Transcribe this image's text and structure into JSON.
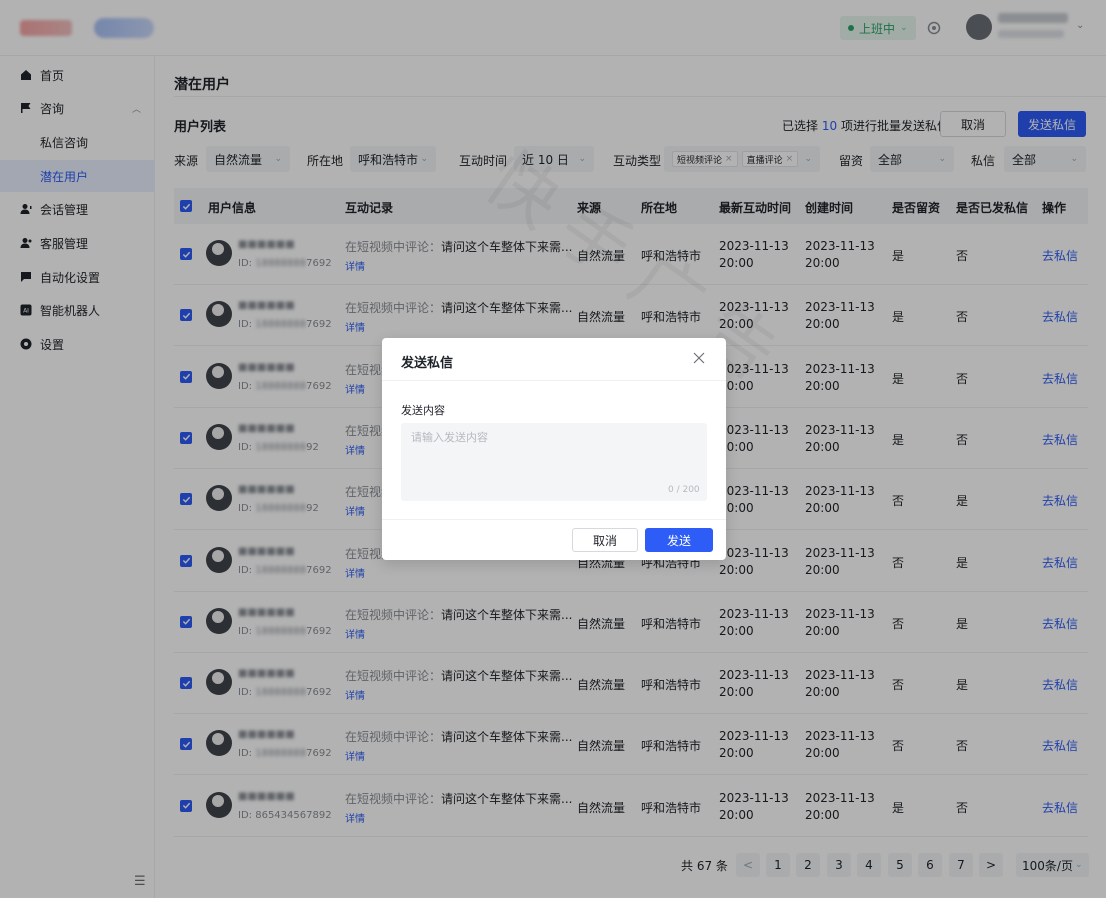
{
  "header": {
    "status_label": "上班中"
  },
  "sidebar": {
    "items": [
      {
        "label": "首页",
        "icon": "home-icon"
      },
      {
        "label": "咨询",
        "icon": "flag-icon"
      },
      {
        "label": "私信咨询"
      },
      {
        "label": "潜在用户"
      },
      {
        "label": "会话管理",
        "icon": "user-chat-icon"
      },
      {
        "label": "客服管理",
        "icon": "users-icon"
      },
      {
        "label": "自动化设置",
        "icon": "message-icon"
      },
      {
        "label": "智能机器人",
        "icon": "ai-icon"
      },
      {
        "label": "设置",
        "icon": "settings-icon"
      }
    ]
  },
  "main": {
    "page_title": "潜在用户",
    "list_title": "用户列表",
    "selected_prefix": "已选择",
    "selected_count": "10",
    "selected_suffix": "项进行批量发送私信",
    "cancel_label": "取消",
    "send_label": "发送私信",
    "watermark": "快手广告"
  },
  "filters": {
    "source_label": "来源",
    "source_value": "自然流量",
    "location_label": "所在地",
    "location_value": "呼和浩特市",
    "time_label": "互动时间",
    "time_value": "近 10 日",
    "type_label": "互动类型",
    "type_tags": [
      "短视频评论",
      "直播评论"
    ],
    "lead_label": "留资",
    "lead_value": "全部",
    "dm_label": "私信",
    "dm_value": "全部"
  },
  "table": {
    "headers": [
      "用户信息",
      "互动记录",
      "来源",
      "所在地",
      "最新互动时间",
      "创建时间",
      "是否留资",
      "是否已发私信",
      "操作"
    ],
    "rows": [
      {
        "id_prefix": "ID:",
        "id_blur": "18888888",
        "id_tail": "7692",
        "record_prefix": "在短视频中评论：",
        "record": "请问这个车整体下来需...",
        "detail": "详情",
        "source": "自然流量",
        "location": "呼和浩特市",
        "latest_date": "2023-11-13",
        "latest_time": "20:00",
        "created_date": "2023-11-13",
        "created_time": "20:00",
        "lead": "是",
        "dm": "否",
        "op": "去私信"
      },
      {
        "id_prefix": "ID:",
        "id_blur": "18888888",
        "id_tail": "7692",
        "record_prefix": "在短视频中评论：",
        "record": "请问这个车整体下来需...",
        "detail": "详情",
        "source": "自然流量",
        "location": "呼和浩特市",
        "latest_date": "2023-11-13",
        "latest_time": "20:00",
        "created_date": "2023-11-13",
        "created_time": "20:00",
        "lead": "是",
        "dm": "否",
        "op": "去私信"
      },
      {
        "id_prefix": "ID:",
        "id_blur": "18888888",
        "id_tail": "7692",
        "record_prefix": "在短视频中评论：",
        "record": "请问这个车整体下来需...",
        "detail": "详情",
        "source": "自然流量",
        "location": "呼和浩特市",
        "latest_date": "2023-11-13",
        "latest_time": "20:00",
        "created_date": "2023-11-13",
        "created_time": "20:00",
        "lead": "是",
        "dm": "否",
        "op": "去私信"
      },
      {
        "id_prefix": "ID:",
        "id_blur": "18888888",
        "id_tail": "92",
        "record_prefix": "在短视频中评论：",
        "record": "请问这个车整体下来需...",
        "detail": "详情",
        "source": "自然流量",
        "location": "呼和浩特市",
        "latest_date": "2023-11-13",
        "latest_time": "20:00",
        "created_date": "2023-11-13",
        "created_time": "20:00",
        "lead": "是",
        "dm": "否",
        "op": "去私信"
      },
      {
        "id_prefix": "ID:",
        "id_blur": "18888888",
        "id_tail": "92",
        "record_prefix": "在短视频中评论：",
        "record": "请问这个车整体下来需...",
        "detail": "详情",
        "source": "自然流量",
        "location": "呼和浩特市",
        "latest_date": "2023-11-13",
        "latest_time": "20:00",
        "created_date": "2023-11-13",
        "created_time": "20:00",
        "lead": "否",
        "dm": "是",
        "op": "去私信"
      },
      {
        "id_prefix": "ID:",
        "id_blur": "18888888",
        "id_tail": "7692",
        "record_prefix": "在短视频中评论：",
        "record": "请问这个车整体下来需...",
        "detail": "详情",
        "source": "自然流量",
        "location": "呼和浩特市",
        "latest_date": "2023-11-13",
        "latest_time": "20:00",
        "created_date": "2023-11-13",
        "created_time": "20:00",
        "lead": "否",
        "dm": "是",
        "op": "去私信"
      },
      {
        "id_prefix": "ID:",
        "id_blur": "18888888",
        "id_tail": "7692",
        "record_prefix": "在短视频中评论：",
        "record": "请问这个车整体下来需...",
        "detail": "详情",
        "source": "自然流量",
        "location": "呼和浩特市",
        "latest_date": "2023-11-13",
        "latest_time": "20:00",
        "created_date": "2023-11-13",
        "created_time": "20:00",
        "lead": "否",
        "dm": "是",
        "op": "去私信"
      },
      {
        "id_prefix": "ID:",
        "id_blur": "18888888",
        "id_tail": "7692",
        "record_prefix": "在短视频中评论：",
        "record": "请问这个车整体下来需...",
        "detail": "详情",
        "source": "自然流量",
        "location": "呼和浩特市",
        "latest_date": "2023-11-13",
        "latest_time": "20:00",
        "created_date": "2023-11-13",
        "created_time": "20:00",
        "lead": "否",
        "dm": "是",
        "op": "去私信"
      },
      {
        "id_prefix": "ID:",
        "id_blur": "18888888",
        "id_tail": "7692",
        "record_prefix": "在短视频中评论：",
        "record": "请问这个车整体下来需...",
        "detail": "详情",
        "source": "自然流量",
        "location": "呼和浩特市",
        "latest_date": "2023-11-13",
        "latest_time": "20:00",
        "created_date": "2023-11-13",
        "created_time": "20:00",
        "lead": "否",
        "dm": "否",
        "op": "去私信"
      },
      {
        "id_prefix": "ID:",
        "id_blur": "",
        "id_tail": "865434567892",
        "record_prefix": "在短视频中评论：",
        "record": "请问这个车整体下来需...",
        "detail": "详情",
        "source": "自然流量",
        "location": "呼和浩特市",
        "latest_date": "2023-11-13",
        "latest_time": "20:00",
        "created_date": "2023-11-13",
        "created_time": "20:00",
        "lead": "是",
        "dm": "否",
        "op": "去私信"
      }
    ]
  },
  "pagination": {
    "total": "共 67 条",
    "prev": "<",
    "pages": [
      "1",
      "2",
      "3",
      "4",
      "5",
      "6",
      "7"
    ],
    "next": ">",
    "page_size": "100条/页"
  },
  "modal": {
    "title": "发送私信",
    "field_label": "发送内容",
    "placeholder": "请输入发送内容",
    "counter": "0 / 200",
    "cancel": "取消",
    "send": "发送"
  },
  "colors": {
    "primary": "#2d5cf6",
    "status_green": "#2ba36a",
    "overlay": "rgba(0,0,0,0.3)"
  }
}
